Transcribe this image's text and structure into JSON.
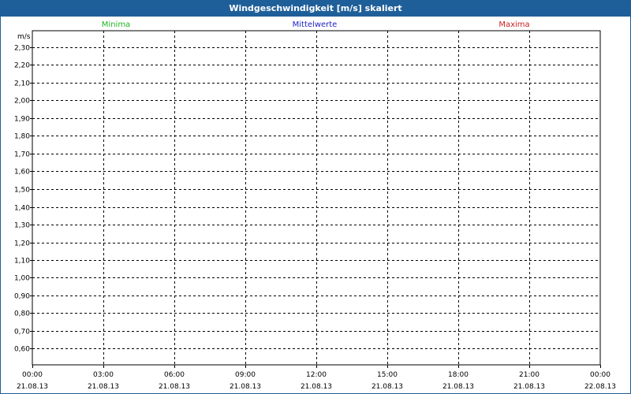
{
  "window": {
    "title": "Windgeschwindigkeit [m/s] skaliert"
  },
  "chart_data": {
    "type": "line",
    "title": "Windgeschwindigkeit [m/s] skaliert",
    "ylabel": "m/s",
    "xlabel": "",
    "ylim": [
      0.55,
      2.33
    ],
    "xlim": [
      "21.08.13 00:00",
      "22.08.13 00:00"
    ],
    "grid": true,
    "legend_placement": "top",
    "yticks": [
      "2,30",
      "2,20",
      "2,10",
      "2,00",
      "1,90",
      "1,80",
      "1,70",
      "1,60",
      "1,50",
      "1,40",
      "1,30",
      "1,20",
      "1,10",
      "1,00",
      "0,90",
      "0,80",
      "0,70",
      "0,60"
    ],
    "ytick_values": [
      2.3,
      2.2,
      2.1,
      2.0,
      1.9,
      1.8,
      1.7,
      1.6,
      1.5,
      1.4,
      1.3,
      1.2,
      1.1,
      1.0,
      0.9,
      0.8,
      0.7,
      0.6
    ],
    "xticks": [
      {
        "time": "00:00",
        "date": "21.08.13"
      },
      {
        "time": "03:00",
        "date": "21.08.13"
      },
      {
        "time": "06:00",
        "date": "21.08.13"
      },
      {
        "time": "09:00",
        "date": "21.08.13"
      },
      {
        "time": "12:00",
        "date": "21.08.13"
      },
      {
        "time": "15:00",
        "date": "21.08.13"
      },
      {
        "time": "18:00",
        "date": "21.08.13"
      },
      {
        "time": "21:00",
        "date": "21.08.13"
      },
      {
        "time": "00:00",
        "date": "22.08.13"
      }
    ],
    "series": [
      {
        "name": "Minima",
        "color": "#22b422",
        "values": []
      },
      {
        "name": "Mittelwerte",
        "color": "#2222c8",
        "values": []
      },
      {
        "name": "Maxima",
        "color": "#c82222",
        "values": []
      }
    ]
  }
}
